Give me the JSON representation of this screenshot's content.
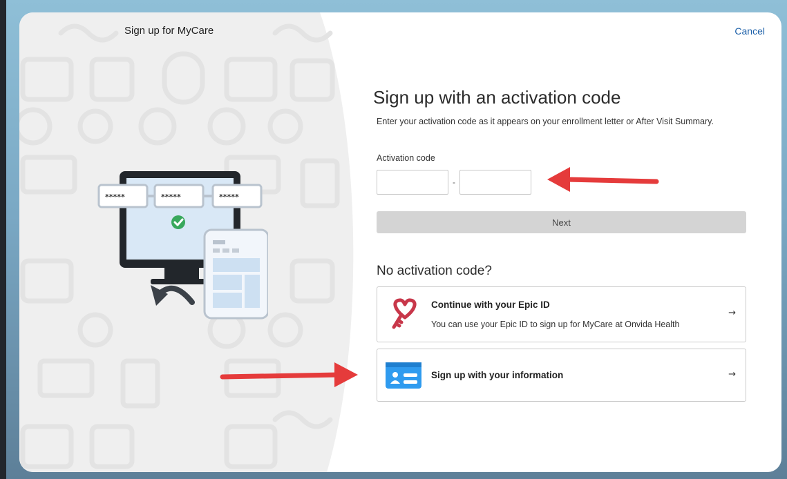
{
  "header": {
    "title": "Sign up for MyCare",
    "cancel_label": "Cancel"
  },
  "main": {
    "heading": "Sign up with an activation code",
    "description": "Enter your activation code as it appears on your enrollment letter or After Visit Summary.",
    "activation_label": "Activation code",
    "code_part1_value": "",
    "code_part2_value": "",
    "code_separator": "-",
    "next_label": "Next",
    "no_code_heading": "No activation code?"
  },
  "options": [
    {
      "title": "Continue with your Epic ID",
      "subtitle": "You can use your Epic ID to sign up for MyCare at Onvida Health",
      "icon": "epic-key-icon",
      "arrow": "→"
    },
    {
      "title": "Sign up with your information",
      "icon": "id-card-icon",
      "arrow": "→"
    }
  ],
  "illustration": {
    "masked_code": "*****",
    "icons": [
      "monitor-icon",
      "check-icon",
      "document-icon",
      "curved-arrow-icon"
    ]
  },
  "colors": {
    "link": "#1b5fa8",
    "button_disabled": "#d4d4d4",
    "epic_key": "#c8374a",
    "id_card": "#2f9bef",
    "check": "#38a85c",
    "annotation_arrow": "#e53b3b"
  }
}
